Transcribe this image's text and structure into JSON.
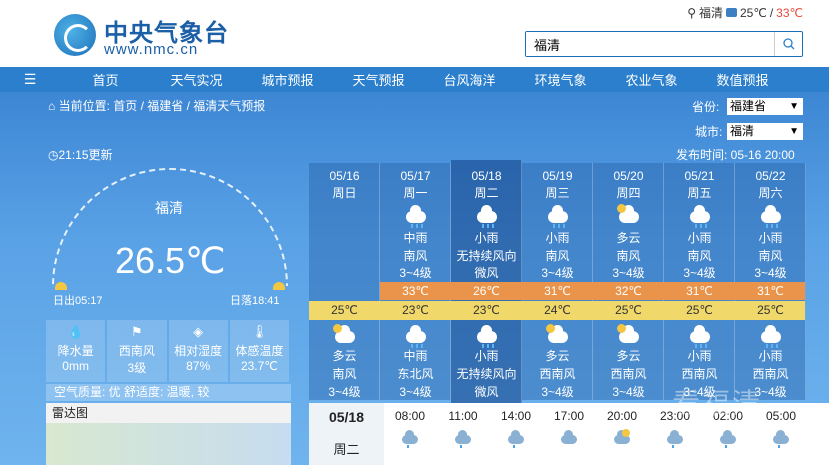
{
  "header": {
    "logo_cn": "中央气象台",
    "logo_en": "www.nmc.cn",
    "loc_city": "福清",
    "loc_low": "25℃",
    "loc_sep": "/",
    "loc_high": "33℃",
    "search_value": "福清"
  },
  "nav": [
    "首页",
    "天气实况",
    "城市预报",
    "天气预报",
    "台风海洋",
    "环境气象",
    "农业气象",
    "数值预报"
  ],
  "crumb": "当前位置: 首页 / 福建省 / 福清天气预报",
  "province_label": "省份:",
  "province_value": "福建省",
  "city_label": "城市:",
  "city_value": "福清",
  "updated": "21:15更新",
  "pubtime": "发布时间: 05-16 20:00",
  "current": {
    "city": "福清",
    "temp": "26.5℃",
    "sunrise": "日出05:17",
    "sunset": "日落18:41"
  },
  "stats": [
    {
      "label": "降水量",
      "value": "0mm"
    },
    {
      "label": "西南风",
      "value": "3级"
    },
    {
      "label": "相对湿度",
      "value": "87%"
    },
    {
      "label": "体感温度",
      "value": "23.7℃"
    }
  ],
  "quality": "空气质量: 优     舒适度: 温暖, 较",
  "radar_title": "雷达图",
  "days": [
    {
      "date": "05/16",
      "week": "周日",
      "day_weather": "",
      "day_wind": "",
      "day_level": "",
      "high": "",
      "low": "25℃",
      "night_weather": "多云",
      "night_wind": "南风",
      "night_level": "3~4级",
      "day_icon": "",
      "night_icon": "cloud-sun"
    },
    {
      "date": "05/17",
      "week": "周一",
      "day_weather": "中雨",
      "day_wind": "南风",
      "day_level": "3~4级",
      "high": "33℃",
      "low": "23℃",
      "night_weather": "中雨",
      "night_wind": "东北风",
      "night_level": "3~4级",
      "day_icon": "rain",
      "night_icon": "rain"
    },
    {
      "date": "05/18",
      "week": "周二",
      "day_weather": "小雨",
      "day_wind": "无持续风向",
      "day_level": "微风",
      "high": "26℃",
      "low": "23℃",
      "night_weather": "小雨",
      "night_wind": "无持续风向",
      "night_level": "微风",
      "day_icon": "rain",
      "night_icon": "rain"
    },
    {
      "date": "05/19",
      "week": "周三",
      "day_weather": "小雨",
      "day_wind": "南风",
      "day_level": "3~4级",
      "high": "31℃",
      "low": "24℃",
      "night_weather": "多云",
      "night_wind": "西南风",
      "night_level": "3~4级",
      "day_icon": "rain",
      "night_icon": "cloud-sun"
    },
    {
      "date": "05/20",
      "week": "周四",
      "day_weather": "多云",
      "day_wind": "南风",
      "day_level": "3~4级",
      "high": "32℃",
      "low": "25℃",
      "night_weather": "多云",
      "night_wind": "西南风",
      "night_level": "3~4级",
      "day_icon": "cloud-sun",
      "night_icon": "cloud-sun"
    },
    {
      "date": "05/21",
      "week": "周五",
      "day_weather": "小雨",
      "day_wind": "南风",
      "day_level": "3~4级",
      "high": "31℃",
      "low": "25℃",
      "night_weather": "小雨",
      "night_wind": "西南风",
      "night_level": "3~4级",
      "day_icon": "rain",
      "night_icon": "rain"
    },
    {
      "date": "05/22",
      "week": "周六",
      "day_weather": "小雨",
      "day_wind": "南风",
      "day_level": "3~4级",
      "high": "31℃",
      "low": "25℃",
      "night_weather": "小雨",
      "night_wind": "西南风",
      "night_level": "3~4级",
      "day_icon": "rain",
      "night_icon": "rain"
    }
  ],
  "hourly": {
    "date": "05/18",
    "week": "周二",
    "times": [
      "08:00",
      "11:00",
      "14:00",
      "17:00",
      "20:00",
      "23:00",
      "02:00",
      "05:00"
    ],
    "icons": [
      "rain",
      "rain",
      "rain",
      "cloud",
      "cloud-sun",
      "rain",
      "rain",
      "rain"
    ]
  },
  "watermark": "看福清"
}
